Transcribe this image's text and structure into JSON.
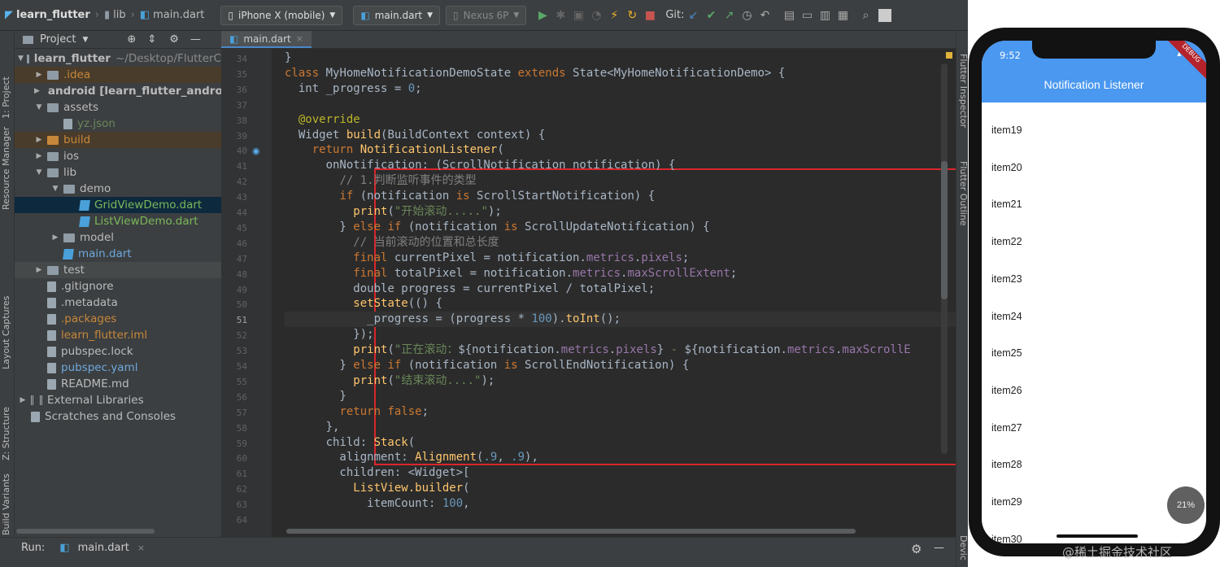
{
  "toolbar": {
    "project": "learn_flutter",
    "folder": "lib",
    "file": "main.dart",
    "device": "iPhone X (mobile)",
    "config": "main.dart",
    "emulator": "Nexus 6P",
    "git_label": "Git:"
  },
  "left_tabs": [
    "1: Project",
    "Resource Manager",
    "Layout Captures",
    "Z: Structure",
    "Build Variants"
  ],
  "project_panel": {
    "title": "Project",
    "rows": [
      {
        "label": "learn_flutter",
        "suffix": "~/Desktop/FlutterC",
        "depth": 0,
        "arrow": "▼",
        "icon": "folder",
        "color": "#bbbbbb",
        "bold": true
      },
      {
        "label": ".idea",
        "depth": 1,
        "arrow": "▶",
        "icon": "folder",
        "color": "#c7873a",
        "hl": true
      },
      {
        "label": "android [learn_flutter_andro",
        "depth": 1,
        "arrow": "▶",
        "icon": "folder",
        "color": "#bbbbbb",
        "bold": true
      },
      {
        "label": "assets",
        "depth": 1,
        "arrow": "▼",
        "icon": "folder",
        "color": "#bbbbbb"
      },
      {
        "label": "yz.json",
        "depth": 2,
        "arrow": "",
        "icon": "file",
        "color": "#6a8759"
      },
      {
        "label": "build",
        "depth": 1,
        "arrow": "▶",
        "icon": "folder-orange",
        "color": "#c7873a",
        "hl": true
      },
      {
        "label": "ios",
        "depth": 1,
        "arrow": "▶",
        "icon": "folder",
        "color": "#bbbbbb"
      },
      {
        "label": "lib",
        "depth": 1,
        "arrow": "▼",
        "icon": "folder",
        "color": "#bbbbbb"
      },
      {
        "label": "demo",
        "depth": 2,
        "arrow": "▼",
        "icon": "folder",
        "color": "#bbbbbb"
      },
      {
        "label": "GridViewDemo.dart",
        "depth": 3,
        "arrow": "",
        "icon": "dart",
        "color": "#7ab85a",
        "sel": true
      },
      {
        "label": "ListViewDemo.dart",
        "depth": 3,
        "arrow": "",
        "icon": "dart",
        "color": "#7ab85a"
      },
      {
        "label": "model",
        "depth": 2,
        "arrow": "▶",
        "icon": "folder",
        "color": "#bbbbbb"
      },
      {
        "label": "main.dart",
        "depth": 2,
        "arrow": "",
        "icon": "dart",
        "color": "#6fa8dc"
      },
      {
        "label": "test",
        "depth": 1,
        "arrow": "▶",
        "icon": "folder",
        "color": "#bbbbbb",
        "hl2": true
      },
      {
        "label": ".gitignore",
        "depth": 1,
        "arrow": "",
        "icon": "file",
        "color": "#bbbbbb"
      },
      {
        "label": ".metadata",
        "depth": 1,
        "arrow": "",
        "icon": "file",
        "color": "#bbbbbb"
      },
      {
        "label": ".packages",
        "depth": 1,
        "arrow": "",
        "icon": "file",
        "color": "#c7873a"
      },
      {
        "label": "learn_flutter.iml",
        "depth": 1,
        "arrow": "",
        "icon": "file",
        "color": "#c7873a"
      },
      {
        "label": "pubspec.lock",
        "depth": 1,
        "arrow": "",
        "icon": "file",
        "color": "#bbbbbb"
      },
      {
        "label": "pubspec.yaml",
        "depth": 1,
        "arrow": "",
        "icon": "file",
        "color": "#6fa8dc"
      },
      {
        "label": "README.md",
        "depth": 1,
        "arrow": "",
        "icon": "file",
        "color": "#bbbbbb"
      },
      {
        "label": "External Libraries",
        "depth": 0,
        "arrow": "▶",
        "icon": "lib",
        "color": "#bbbbbb"
      },
      {
        "label": "Scratches and Consoles",
        "depth": 0,
        "arrow": "",
        "icon": "file",
        "color": "#bbbbbb"
      }
    ]
  },
  "editor": {
    "tab": "main.dart",
    "current_line": 51,
    "lines": [
      {
        "n": 34,
        "html": "<span class=\"ty\">}</span>",
        "indent": 0
      },
      {
        "n": 35,
        "html": "",
        "indent": 0
      },
      {
        "n": 35,
        "html": "<span class=\"kw\">class</span> MyHomeNotificationDemoState <span class=\"kw\">extends</span> State&lt;MyHomeNotificationDemo&gt; {",
        "indent": 0
      },
      {
        "n": 36,
        "html": "  <span class=\"ty\">int</span> _progress = <span class=\"nm\">0</span>;",
        "indent": 0
      },
      {
        "n": 37,
        "html": "",
        "indent": 0
      },
      {
        "n": 38,
        "html": "  <span class=\"an\">@override</span>",
        "indent": 0
      },
      {
        "n": 39,
        "html": "  Widget <span class=\"fn\">build</span>(BuildContext context) {",
        "indent": 0
      },
      {
        "n": 40,
        "html": "    <span class=\"kw\">return</span> <span class=\"fn\">NotificationListener</span>(",
        "indent": 0
      },
      {
        "n": 41,
        "html": "      onNotification: (ScrollNotification notification) {",
        "indent": 0
      },
      {
        "n": 42,
        "html": "        <span class=\"cm\">// 1.判断监听事件的类型</span>",
        "indent": 0
      },
      {
        "n": 43,
        "html": "        <span class=\"kw\">if</span> (notification <span class=\"kw\">is</span> ScrollStartNotification) {",
        "indent": 0
      },
      {
        "n": 44,
        "html": "          <span class=\"fn\">print</span>(<span class=\"st\">\"开始滚动.....\"</span>);",
        "indent": 0
      },
      {
        "n": 45,
        "html": "        } <span class=\"kw\">else if</span> (notification <span class=\"kw\">is</span> ScrollUpdateNotification) {",
        "indent": 0
      },
      {
        "n": 46,
        "html": "          <span class=\"cm\">// 当前滚动的位置和总长度</span>",
        "indent": 0
      },
      {
        "n": 47,
        "html": "          <span class=\"kw\">final</span> currentPixel = notification.<span class=\"fld\">metrics</span>.<span class=\"fld\">pixels</span>;",
        "indent": 0
      },
      {
        "n": 48,
        "html": "          <span class=\"kw\">final</span> totalPixel = notification.<span class=\"fld\">metrics</span>.<span class=\"fld\">maxScrollExtent</span>;",
        "indent": 0
      },
      {
        "n": 49,
        "html": "          <span class=\"ty\">double</span> progress = currentPixel / totalPixel;",
        "indent": 0
      },
      {
        "n": 50,
        "html": "          <span class=\"fn\">setState</span>(() {",
        "indent": 0
      },
      {
        "n": 51,
        "html": "            _progress = (progress * <span class=\"nm\">100</span>).<span class=\"fn\">toInt</span>();",
        "indent": 0
      },
      {
        "n": 52,
        "html": "          });",
        "indent": 0
      },
      {
        "n": 53,
        "html": "          <span class=\"fn\">print</span>(<span class=\"st\">\"正在滚动：</span>${notification.<span class=\"fld\">metrics</span>.<span class=\"fld\">pixels</span>} <span class=\"st\">-</span> ${notification.<span class=\"fld\">metrics</span>.<span class=\"fld\">maxScrollE</span>",
        "indent": 0
      },
      {
        "n": 54,
        "html": "        } <span class=\"kw\">else if</span> (notification <span class=\"kw\">is</span> ScrollEndNotification) {",
        "indent": 0
      },
      {
        "n": 55,
        "html": "          <span class=\"fn\">print</span>(<span class=\"st\">\"结束滚动....\"</span>);",
        "indent": 0
      },
      {
        "n": 56,
        "html": "        }",
        "indent": 0
      },
      {
        "n": 57,
        "html": "        <span class=\"kw\">return false</span>;",
        "indent": 0
      },
      {
        "n": 58,
        "html": "      },",
        "indent": 0
      },
      {
        "n": 59,
        "html": "      child: <span class=\"fn\">Stack</span>(",
        "indent": 0
      },
      {
        "n": 60,
        "html": "        alignment: <span class=\"fn\">Alignment</span>(<span class=\"nm\">.9</span>, <span class=\"nm\">.9</span>),",
        "indent": 0
      },
      {
        "n": 61,
        "html": "        children: &lt;Widget&gt;[",
        "indent": 0
      },
      {
        "n": 62,
        "html": "          <span class=\"fn\">ListView.builder</span>(",
        "indent": 0
      },
      {
        "n": 63,
        "html": "            itemCount: <span class=\"nm\">100</span>,",
        "indent": 0
      },
      {
        "n": 64,
        "html": "",
        "indent": 0
      }
    ]
  },
  "right_tabs": [
    "Flutter Inspector",
    "Flutter Outline",
    "Devic"
  ],
  "bottom": {
    "run_label": "Run:",
    "run_tab": "main.dart"
  },
  "phone": {
    "time": "9:52",
    "debug_banner": "DEBUG",
    "title": "Notification Listener",
    "items": [
      "item19",
      "item20",
      "item21",
      "item22",
      "item23",
      "item24",
      "item25",
      "item26",
      "item27",
      "item28",
      "item29",
      "item30"
    ],
    "progress_label": "21%"
  },
  "watermark": "@稀土掘金技术社区"
}
